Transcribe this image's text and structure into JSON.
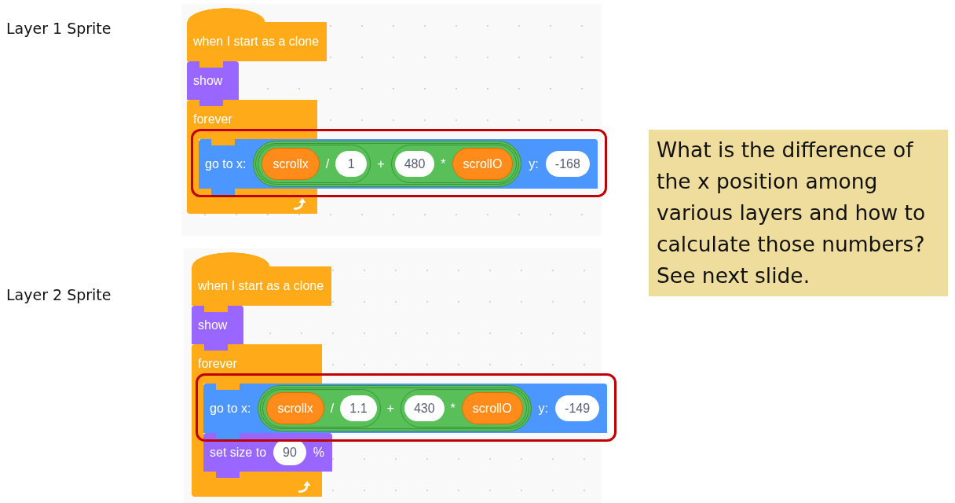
{
  "scripts": [
    {
      "label": "Layer 1 Sprite",
      "blocks": [
        {
          "kind": "hat",
          "color": "#ffab19",
          "highlighted": false,
          "text": "when I start as a clone"
        },
        {
          "kind": "stack",
          "color": "#9966ff",
          "highlighted": false,
          "text": "show"
        },
        {
          "kind": "c",
          "color": "#ffab19",
          "highlighted": false,
          "text": "forever",
          "children": [
            {
              "kind": "stack",
              "color": "#4c97ff",
              "highlighted": true,
              "items": [
                {
                  "kind": "label",
                  "text": "go to x:"
                },
                {
                  "kind": "operator",
                  "items": [
                    {
                      "kind": "operator",
                      "items": [
                        {
                          "kind": "variable",
                          "text": "scrollx"
                        },
                        {
                          "kind": "symbol",
                          "text": "/"
                        },
                        {
                          "kind": "number",
                          "text": "1"
                        }
                      ]
                    },
                    {
                      "kind": "symbol",
                      "text": "+"
                    },
                    {
                      "kind": "operator",
                      "items": [
                        {
                          "kind": "number",
                          "text": "480"
                        },
                        {
                          "kind": "symbol",
                          "text": "*"
                        },
                        {
                          "kind": "variable",
                          "text": "scrollO"
                        }
                      ]
                    }
                  ]
                },
                {
                  "kind": "label",
                  "text": "y:"
                },
                {
                  "kind": "number",
                  "text": "-168"
                }
              ]
            }
          ]
        }
      ]
    },
    {
      "label": "Layer 2 Sprite",
      "blocks": [
        {
          "kind": "hat",
          "color": "#ffab19",
          "highlighted": false,
          "text": "when I start as a clone"
        },
        {
          "kind": "stack",
          "color": "#9966ff",
          "highlighted": false,
          "text": "show"
        },
        {
          "kind": "c",
          "color": "#ffab19",
          "highlighted": false,
          "text": "forever",
          "children": [
            {
              "kind": "stack",
              "color": "#4c97ff",
              "highlighted": true,
              "items": [
                {
                  "kind": "label",
                  "text": "go to x:"
                },
                {
                  "kind": "operator",
                  "items": [
                    {
                      "kind": "operator",
                      "items": [
                        {
                          "kind": "variable",
                          "text": "scrollx"
                        },
                        {
                          "kind": "symbol",
                          "text": "/"
                        },
                        {
                          "kind": "number",
                          "text": "1.1"
                        }
                      ]
                    },
                    {
                      "kind": "symbol",
                      "text": "+"
                    },
                    {
                      "kind": "operator",
                      "items": [
                        {
                          "kind": "number",
                          "text": "430"
                        },
                        {
                          "kind": "symbol",
                          "text": "*"
                        },
                        {
                          "kind": "variable",
                          "text": "scrollO"
                        }
                      ]
                    }
                  ]
                },
                {
                  "kind": "label",
                  "text": "y:"
                },
                {
                  "kind": "number",
                  "text": "-149"
                }
              ]
            },
            {
              "kind": "stack",
              "color": "#9966ff",
              "highlighted": false,
              "items": [
                {
                  "kind": "label",
                  "text": "set size to"
                },
                {
                  "kind": "number",
                  "text": "90"
                },
                {
                  "kind": "label",
                  "text": "%"
                }
              ]
            }
          ]
        }
      ]
    }
  ],
  "note": "What is the difference of the x position among various layers and how to calculate those numbers? See next slide."
}
